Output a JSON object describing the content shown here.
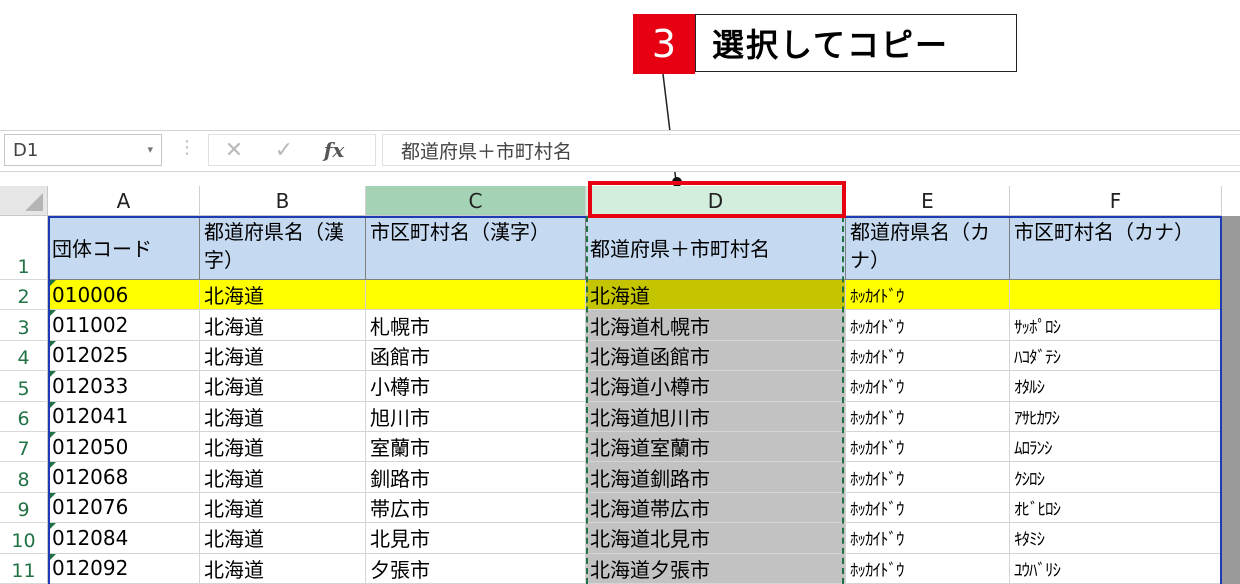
{
  "callout": {
    "number": "3",
    "text": "選択してコピー"
  },
  "formula_bar": {
    "name_box": "D1",
    "name_box_dropdown": "▾",
    "separator": "⋮",
    "cancel_symbol": "✕",
    "enter_symbol": "✓",
    "fx_symbol": "fx",
    "formula": "都道府県＋市町村名"
  },
  "columns": [
    "A",
    "B",
    "C",
    "D",
    "E",
    "F"
  ],
  "row_numbers": [
    "1",
    "2",
    "3",
    "4",
    "5",
    "6",
    "7",
    "8",
    "9",
    "10",
    "11"
  ],
  "header_row": [
    "団体コード",
    "都道府県名（漢字）",
    "市区町村名（漢字）",
    "都道府県＋市町村名",
    "都道府県名（カナ）",
    "市区町村名（カナ）"
  ],
  "rows": [
    [
      "010006",
      "北海道",
      "",
      "北海道",
      "ﾎｯｶｲﾄﾞｳ",
      ""
    ],
    [
      "011002",
      "北海道",
      "札幌市",
      "北海道札幌市",
      "ﾎｯｶｲﾄﾞｳ",
      "ｻｯﾎﾟﾛｼ"
    ],
    [
      "012025",
      "北海道",
      "函館市",
      "北海道函館市",
      "ﾎｯｶｲﾄﾞｳ",
      "ﾊｺﾀﾞﾃｼ"
    ],
    [
      "012033",
      "北海道",
      "小樽市",
      "北海道小樽市",
      "ﾎｯｶｲﾄﾞｳ",
      "ｵﾀﾙｼ"
    ],
    [
      "012041",
      "北海道",
      "旭川市",
      "北海道旭川市",
      "ﾎｯｶｲﾄﾞｳ",
      "ｱｻﾋｶﾜｼ"
    ],
    [
      "012050",
      "北海道",
      "室蘭市",
      "北海道室蘭市",
      "ﾎｯｶｲﾄﾞｳ",
      "ﾑﾛﾗﾝｼ"
    ],
    [
      "012068",
      "北海道",
      "釧路市",
      "北海道釧路市",
      "ﾎｯｶｲﾄﾞｳ",
      "ｸｼﾛｼ"
    ],
    [
      "012076",
      "北海道",
      "帯広市",
      "北海道帯広市",
      "ﾎｯｶｲﾄﾞｳ",
      "ｵﾋﾞﾋﾛｼ"
    ],
    [
      "012084",
      "北海道",
      "北見市",
      "北海道北見市",
      "ﾎｯｶｲﾄﾞｳ",
      "ｷﾀﾐｼ"
    ],
    [
      "012092",
      "北海道",
      "夕張市",
      "北海道夕張市",
      "ﾎｯｶｲﾄﾞｳ",
      "ﾕｳﾊﾞﾘｼ"
    ]
  ],
  "colors": {
    "callout_red": "#e60012",
    "header_fill": "#c5d9f1",
    "highlight_yellow": "#ffff00",
    "selected_column_header": "#d3eedd",
    "copy_marquee": "#217346",
    "table_border": "#1f3bb3"
  }
}
